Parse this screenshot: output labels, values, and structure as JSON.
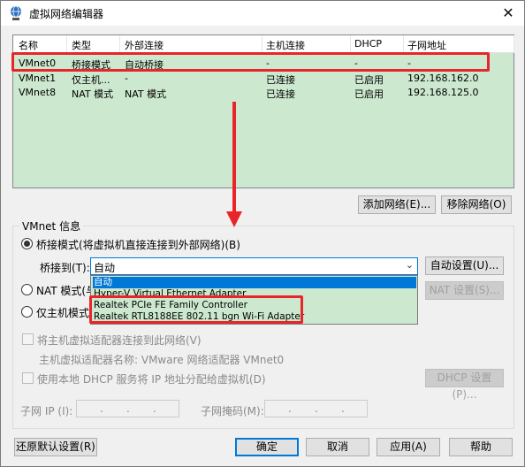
{
  "window": {
    "title": "虚拟网络编辑器",
    "close_glyph": "✕"
  },
  "table": {
    "columns": [
      "名称",
      "类型",
      "外部连接",
      "主机连接",
      "DHCP",
      "子网地址"
    ],
    "rows": [
      [
        "VMnet0",
        "桥接模式",
        "自动桥接",
        "-",
        "-",
        "-"
      ],
      [
        "VMnet1",
        "仅主机...",
        "-",
        "已连接",
        "已启用",
        "192.168.162.0"
      ],
      [
        "VMnet8",
        "NAT 模式",
        "NAT 模式",
        "已连接",
        "已启用",
        "192.168.125.0"
      ]
    ]
  },
  "buttons": {
    "add_network": "添加网络(E)...",
    "remove_network": "移除网络(O)",
    "auto_settings": "自动设置(U)...",
    "nat_settings": "NAT 设置(S)...",
    "dhcp_settings": "DHCP 设置(P)...",
    "restore_defaults": "还原默认设置(R)",
    "ok": "确定",
    "cancel": "取消",
    "apply": "应用(A)",
    "help": "帮助"
  },
  "vmnet_info": {
    "group_label": "VMnet 信息",
    "bridged_label": "桥接模式(将虚拟机直接连接到外部网络)(B)",
    "bridge_to_label": "桥接到(T):",
    "bridge_to_value": "自动",
    "nat_label": "NAT 模式(与",
    "host_only_label": "仅主机模式",
    "connect_adapter_label": "将主机虚拟适配器连接到此网络(V)",
    "adapter_name_label": "主机虚拟适配器名称: VMware 网络适配器 VMnet0",
    "use_dhcp_label": "使用本地 DHCP 服务将 IP 地址分配给虚拟机(D)",
    "subnet_ip_label": "子网 IP (I):",
    "subnet_mask_label": "子网掩码(M):"
  },
  "dropdown": {
    "options": [
      "自动",
      "Hyper-V Virtual Ethernet Adapter",
      "Realtek PCIe FE Family Controller",
      "Realtek RTL8188EE 802.11 bgn Wi-Fi Adapter"
    ],
    "selected_index": 0
  },
  "colors": {
    "highlight_red": "#e8262a",
    "list_bg": "#cce8cf",
    "accent_blue": "#0078d7"
  }
}
